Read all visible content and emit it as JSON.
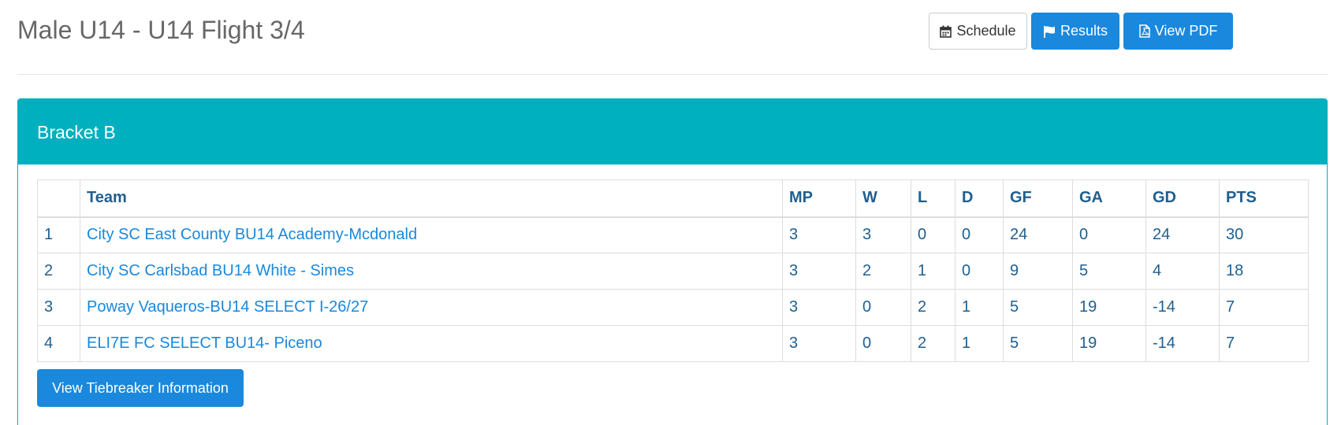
{
  "header": {
    "title": "Male U14 - U14 Flight 3/4",
    "buttons": {
      "schedule_label": "Schedule",
      "results_label": "Results",
      "pdf_label": "View PDF"
    }
  },
  "bracket": {
    "title": "Bracket B",
    "columns": [
      "",
      "Team",
      "MP",
      "W",
      "L",
      "D",
      "GF",
      "GA",
      "GD",
      "PTS"
    ],
    "rows": [
      {
        "rank": "1",
        "team": "City SC East County BU14 Academy-Mcdonald",
        "mp": "3",
        "w": "3",
        "l": "0",
        "d": "0",
        "gf": "24",
        "ga": "0",
        "gd": "24",
        "pts": "30"
      },
      {
        "rank": "2",
        "team": "City SC Carlsbad BU14 White - Simes",
        "mp": "3",
        "w": "2",
        "l": "1",
        "d": "0",
        "gf": "9",
        "ga": "5",
        "gd": "4",
        "pts": "18"
      },
      {
        "rank": "3",
        "team": "Poway Vaqueros-BU14 SELECT I-26/27",
        "mp": "3",
        "w": "0",
        "l": "2",
        "d": "1",
        "gf": "5",
        "ga": "19",
        "gd": "-14",
        "pts": "7"
      },
      {
        "rank": "4",
        "team": "ELI7E FC SELECT BU14- Piceno",
        "mp": "3",
        "w": "0",
        "l": "2",
        "d": "1",
        "gf": "5",
        "ga": "19",
        "gd": "-14",
        "pts": "7"
      }
    ],
    "tiebreaker_label": "View Tiebreaker Information"
  },
  "icons": {
    "schedule": "calendar-icon",
    "results": "flag-icon",
    "pdf": "pdf-file-icon"
  },
  "colors": {
    "primary": "#1a88dc",
    "panel_header": "#00b0bf",
    "table_text": "#1f5f8f",
    "title_text": "#676767"
  }
}
